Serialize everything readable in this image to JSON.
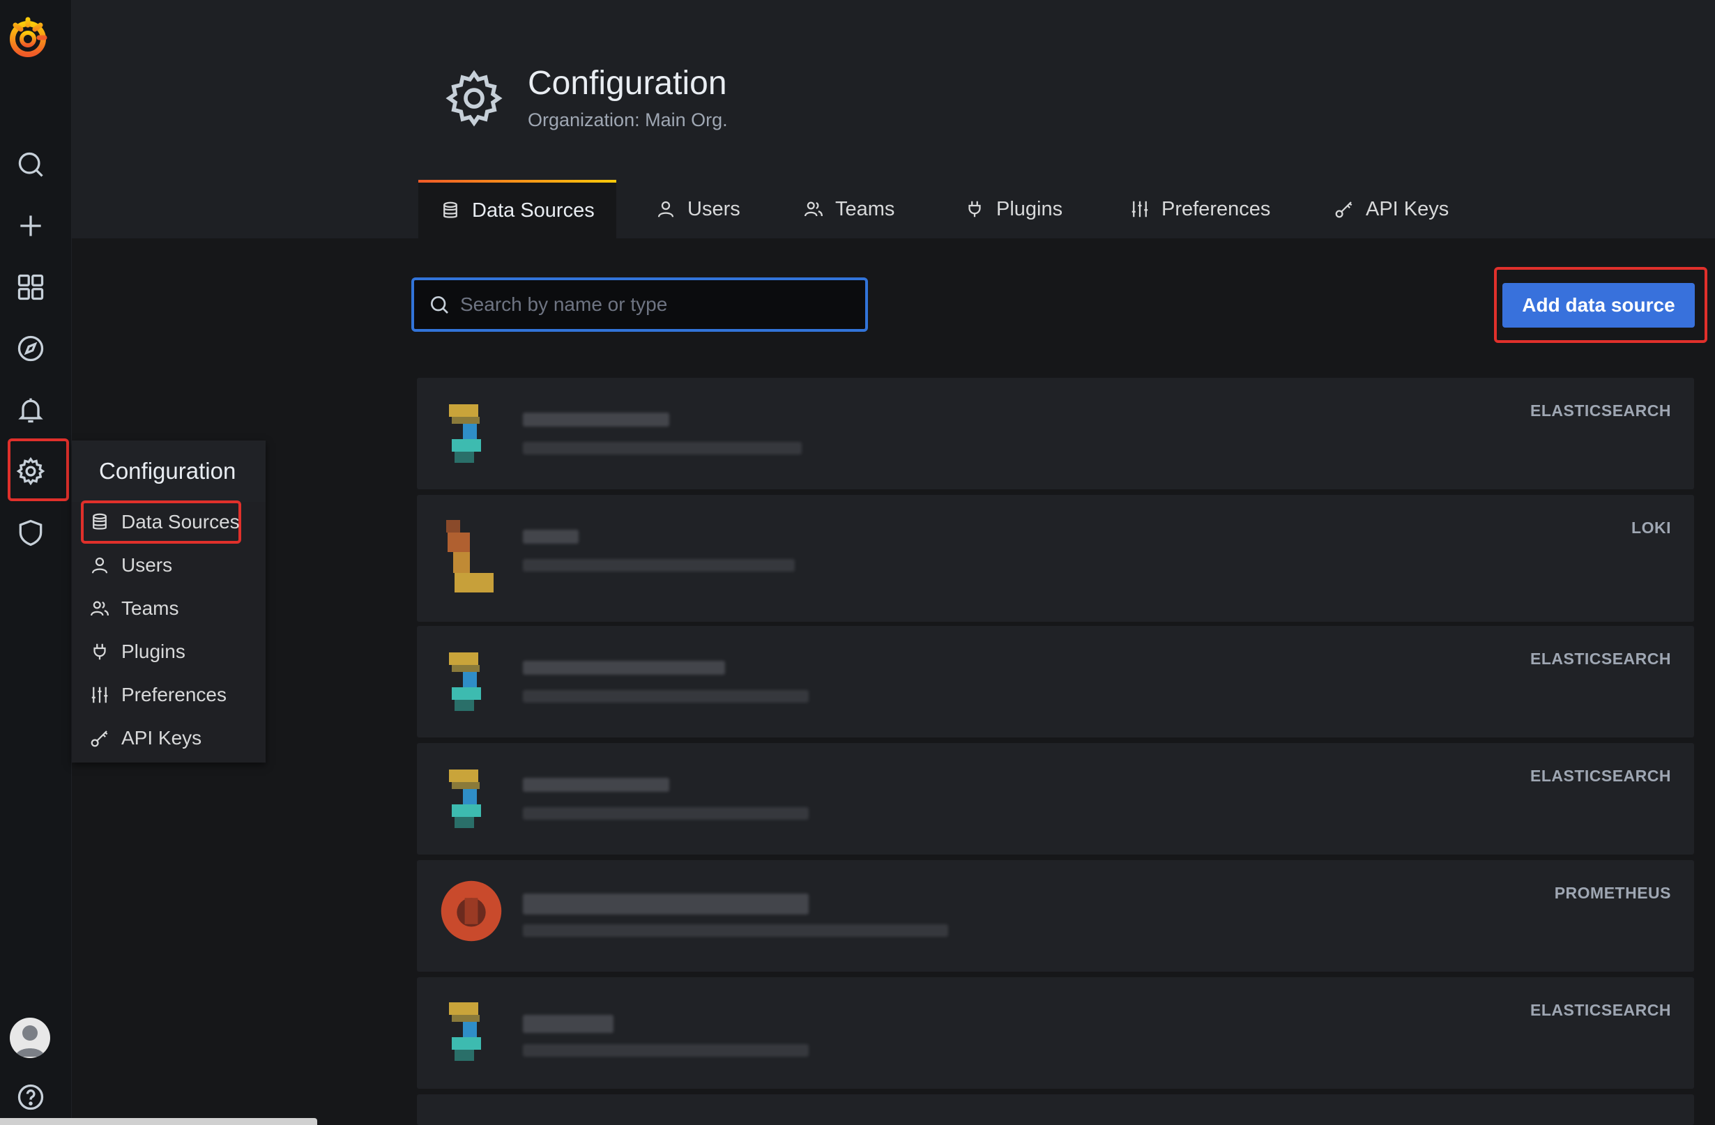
{
  "page": {
    "title": "Configuration",
    "subtitle": "Organization: Main Org."
  },
  "tabs": [
    {
      "label": "Data Sources",
      "icon": "database-icon",
      "active": true
    },
    {
      "label": "Users",
      "icon": "user-icon",
      "active": false
    },
    {
      "label": "Teams",
      "icon": "users-icon",
      "active": false
    },
    {
      "label": "Plugins",
      "icon": "plug-icon",
      "active": false
    },
    {
      "label": "Preferences",
      "icon": "sliders-icon",
      "active": false
    },
    {
      "label": "API Keys",
      "icon": "key-icon",
      "active": false
    }
  ],
  "search": {
    "placeholder": "Search by name or type",
    "value": ""
  },
  "add_button": {
    "label": "Add data source"
  },
  "flyout": {
    "header": "Configuration",
    "items": [
      {
        "label": "Data Sources",
        "icon": "database-icon"
      },
      {
        "label": "Users",
        "icon": "user-icon"
      },
      {
        "label": "Teams",
        "icon": "users-icon"
      },
      {
        "label": "Plugins",
        "icon": "plug-icon"
      },
      {
        "label": "Preferences",
        "icon": "sliders-icon"
      },
      {
        "label": "API Keys",
        "icon": "key-icon"
      }
    ]
  },
  "sidebar": {
    "icons": [
      "grafana-logo",
      "search-icon",
      "plus-icon",
      "dashboards-icon",
      "explore-icon",
      "alert-bell-icon",
      "gear-icon",
      "shield-icon",
      "avatar",
      "help-icon"
    ]
  },
  "datasources": [
    {
      "type": "ELASTICSEARCH"
    },
    {
      "type": "LOKI"
    },
    {
      "type": "ELASTICSEARCH"
    },
    {
      "type": "ELASTICSEARCH"
    },
    {
      "type": "PROMETHEUS"
    },
    {
      "type": "ELASTICSEARCH"
    }
  ],
  "colors": {
    "accent_blue": "#3871dc",
    "highlight_red": "#e0302b",
    "background": "#161719",
    "card": "#202226"
  }
}
